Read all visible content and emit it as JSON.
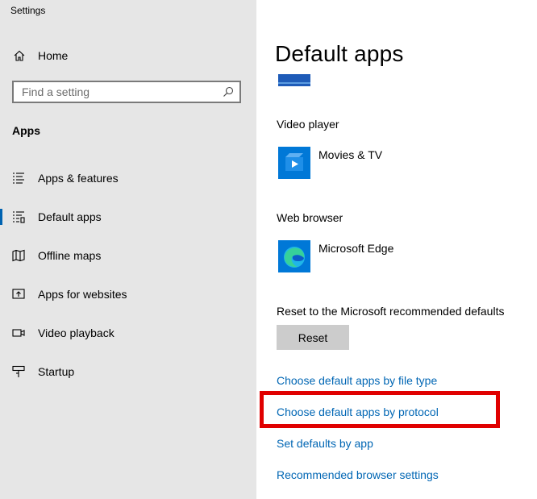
{
  "window": {
    "title": "Settings"
  },
  "sidebar": {
    "home_label": "Home",
    "search": {
      "placeholder": "Find a setting",
      "value": ""
    },
    "section_label": "Apps",
    "items": [
      {
        "label": "Apps & features",
        "icon": "apps-features-icon"
      },
      {
        "label": "Default apps",
        "icon": "default-apps-icon",
        "active": true
      },
      {
        "label": "Offline maps",
        "icon": "offline-maps-icon"
      },
      {
        "label": "Apps for websites",
        "icon": "apps-for-websites-icon"
      },
      {
        "label": "Video playback",
        "icon": "video-playback-icon"
      },
      {
        "label": "Startup",
        "icon": "startup-icon"
      }
    ]
  },
  "main": {
    "title": "Default apps",
    "categories": [
      {
        "label": "Video player",
        "app": "Movies & TV",
        "icon": "movies-tv-icon"
      },
      {
        "label": "Web browser",
        "app": "Microsoft Edge",
        "icon": "microsoft-edge-icon"
      }
    ],
    "reset": {
      "label": "Reset to the Microsoft recommended defaults",
      "button": "Reset"
    },
    "links": [
      "Choose default apps by file type",
      "Choose default apps by protocol",
      "Set defaults by app",
      "Recommended browser settings"
    ]
  },
  "colors": {
    "accent": "#0063b1",
    "link": "#0066b4",
    "highlight": "#e00000",
    "sidebar_bg": "#e6e6e6"
  }
}
